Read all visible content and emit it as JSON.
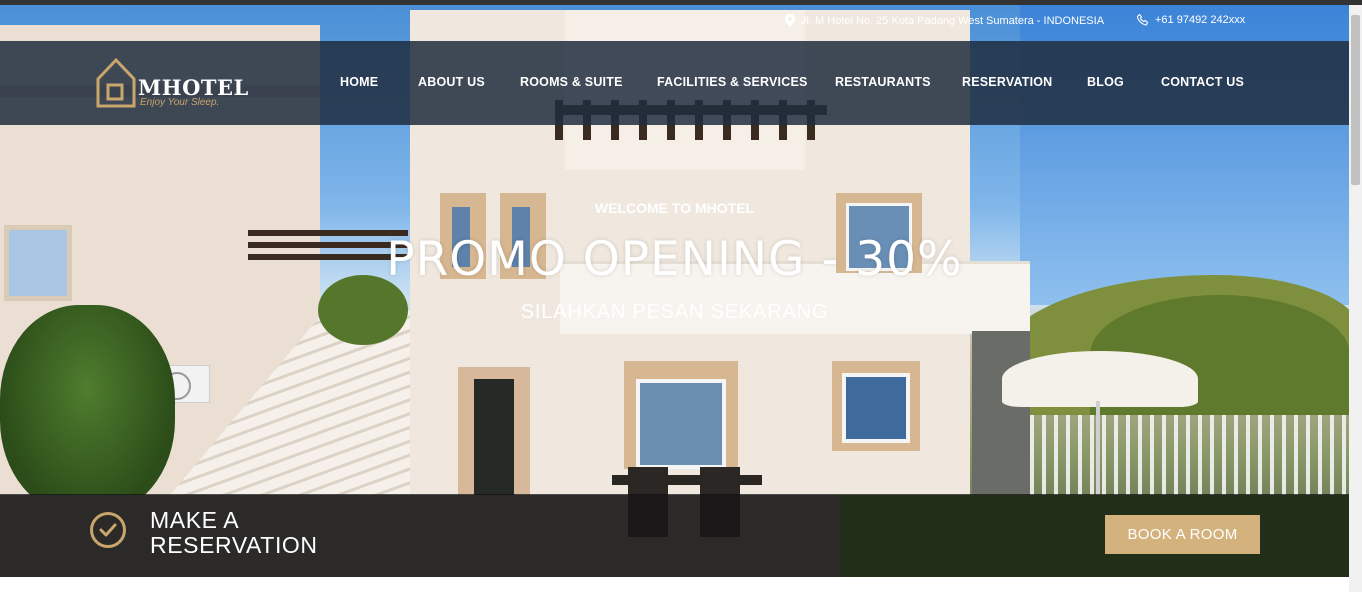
{
  "contact": {
    "address": "Jl. M Hotel No. 25 Kota Padang West Sumatera - INDONESIA",
    "phone": "+61 97492 242xxx",
    "address_icon": "map-pin-icon",
    "phone_icon": "phone-icon"
  },
  "logo": {
    "name": "MHOTEL",
    "tagline": "Enjoy Your Sleep."
  },
  "nav": {
    "items": [
      {
        "label": "HOME"
      },
      {
        "label": "ABOUT US"
      },
      {
        "label": "ROOMS & SUITE"
      },
      {
        "label": "FACILITIES & SERVICES"
      },
      {
        "label": "RESTAURANTS"
      },
      {
        "label": "RESERVATION"
      },
      {
        "label": "BLOG"
      },
      {
        "label": "CONTACT US"
      }
    ]
  },
  "hero": {
    "welcome": "WELCOME TO MHOTEL",
    "headline": "PROMO OPENING - 30%",
    "subheadline": "SILAHKAN PESAN SEKARANG"
  },
  "reservation": {
    "line1": "MAKE A",
    "line2": "RESERVATION",
    "button": "BOOK A ROOM",
    "icon": "check-circle-icon"
  },
  "colors": {
    "accent": "#d4b27d",
    "nav_bg": "#202d3e"
  }
}
